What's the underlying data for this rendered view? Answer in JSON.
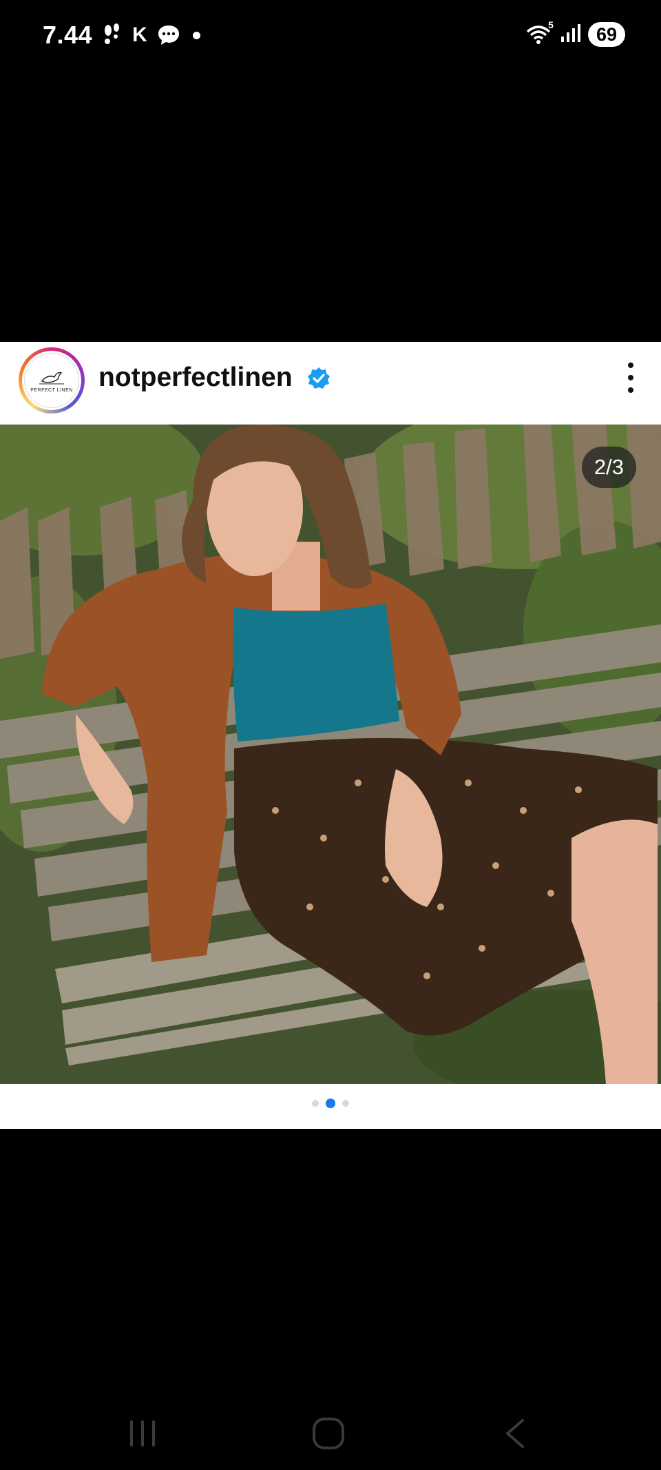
{
  "status_bar": {
    "time": "7.44",
    "carrier_glyph": "K",
    "wifi_badge": "5",
    "battery": "69"
  },
  "post": {
    "username": "notperfectlinen",
    "avatar_text": "PERFECT LINEN",
    "counter": "2/3",
    "carousel": {
      "total": 3,
      "active_index": 1
    },
    "accent_color": "#1877f2"
  },
  "icons": [
    "footsteps-icon",
    "chat-bubble-icon",
    "wifi-icon",
    "signal-icon",
    "verified-badge-icon",
    "more-options-icon",
    "recent-apps-icon",
    "home-icon",
    "back-icon"
  ]
}
